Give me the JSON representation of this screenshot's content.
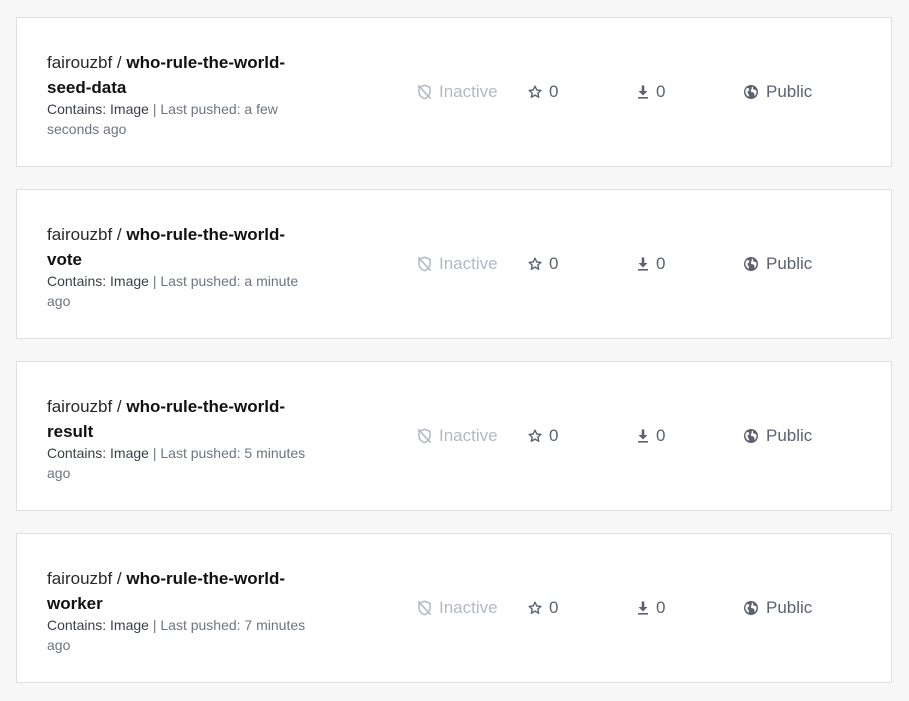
{
  "repositories": [
    {
      "namespace": "fairouzbf",
      "separator": " / ",
      "name": "who-rule-the-world-seed-data",
      "contains_label": "Contains: Image",
      "pipe": " | ",
      "last_pushed": "Last pushed: a few seconds ago",
      "status": "Inactive",
      "stars": "0",
      "pulls": "0",
      "visibility": "Public"
    },
    {
      "namespace": "fairouzbf",
      "separator": " / ",
      "name": "who-rule-the-world-vote",
      "contains_label": "Contains: Image",
      "pipe": " | ",
      "last_pushed": "Last pushed: a minute ago",
      "status": "Inactive",
      "stars": "0",
      "pulls": "0",
      "visibility": "Public"
    },
    {
      "namespace": "fairouzbf",
      "separator": " / ",
      "name": "who-rule-the-world-result",
      "contains_label": "Contains: Image",
      "pipe": " | ",
      "last_pushed": "Last pushed: 5 minutes ago",
      "status": "Inactive",
      "stars": "0",
      "pulls": "0",
      "visibility": "Public"
    },
    {
      "namespace": "fairouzbf",
      "separator": " / ",
      "name": "who-rule-the-world-worker",
      "contains_label": "Contains: Image",
      "pipe": " | ",
      "last_pushed": "Last pushed: 7 minutes ago",
      "status": "Inactive",
      "stars": "0",
      "pulls": "0",
      "visibility": "Public"
    }
  ],
  "icons": {
    "status": "inactive-shield-icon",
    "stars": "star-icon",
    "pulls": "download-icon",
    "visibility": "globe-icon"
  },
  "colors": {
    "page_background": "#f7f7f7",
    "card_background": "#ffffff",
    "card_border": "#e0e0e0",
    "inactive_text": "#b3b8c2",
    "stat_text": "#5c6270"
  }
}
